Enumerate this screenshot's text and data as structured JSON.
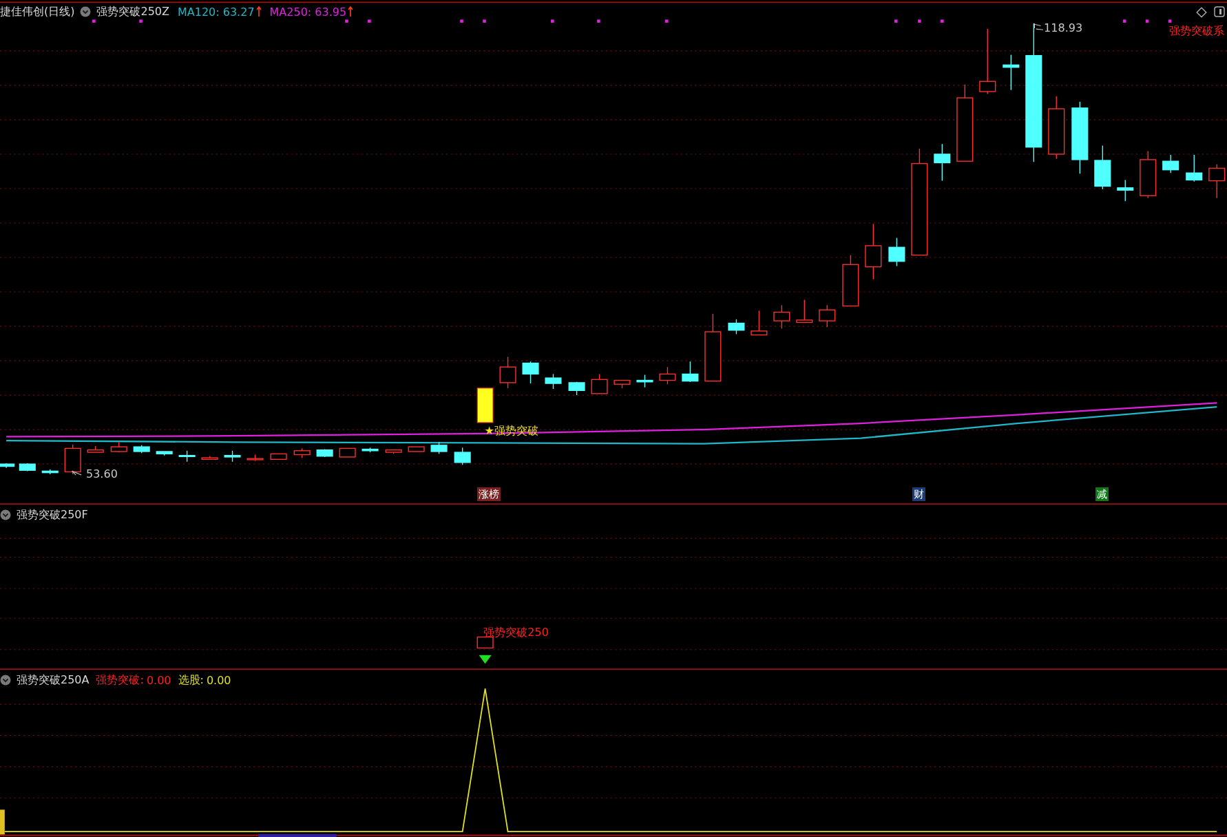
{
  "header": {
    "title": "捷佳伟创(日线)",
    "indicator": "强势突破250Z",
    "averages": [
      {
        "label": "MA120: 63.27",
        "color": "#20b8c8",
        "rising": true
      },
      {
        "label": "MA250: 63.95",
        "color": "#e020e0",
        "rising": true
      }
    ]
  },
  "main_chart": {
    "high_label": "118.93",
    "low_label": "53.60",
    "signal_label": "★强势突破",
    "corner_label": "强势突破系",
    "event_tags": [
      {
        "text": "涨榜",
        "color": "#7a2020"
      },
      {
        "text": "财",
        "color": "#1c3c78"
      },
      {
        "text": "减",
        "color": "#107818"
      }
    ]
  },
  "signal_panel": {
    "title": "强势突破250F",
    "marker_label": "强势突破250"
  },
  "indicator_panel": {
    "title": "强势突破250A",
    "readings": [
      {
        "label": "强势突破:",
        "value": "0.00",
        "color": "#ff2020"
      },
      {
        "label": "选股:",
        "value": "0.00",
        "color": "#e0e020"
      }
    ]
  }
}
